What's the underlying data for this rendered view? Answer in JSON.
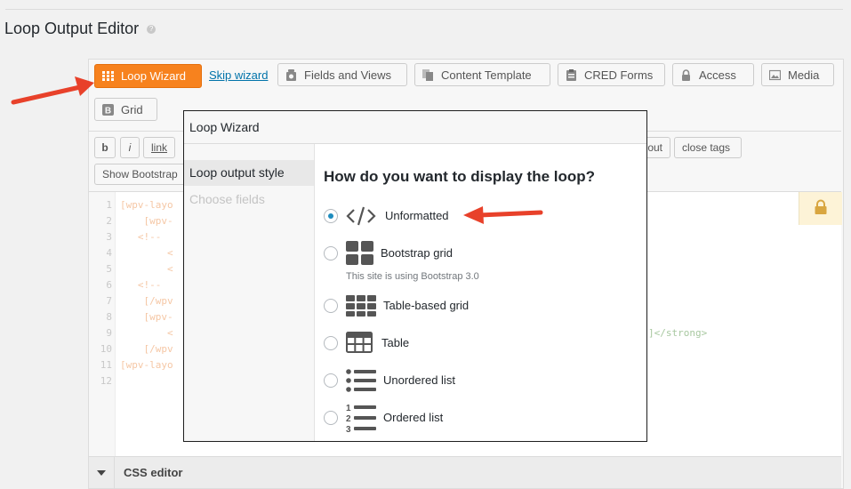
{
  "page": {
    "title": "Loop Output Editor",
    "help": "?"
  },
  "toolbar": {
    "loop_wizard": "Loop Wizard",
    "skip_wizard": "Skip wizard",
    "fields_and_views": "Fields and Views",
    "content_template": "Content Template",
    "cred_forms": "CRED Forms",
    "access": "Access",
    "media": "Media",
    "grid": "Grid"
  },
  "format_buttons": {
    "bold": "b",
    "italic": "i",
    "link": "link",
    "out": "out",
    "close_tags": "close tags",
    "show_bootstrap": "Show Bootstrap"
  },
  "code": {
    "line_numbers": [
      "1",
      "2",
      "3",
      "4",
      "5",
      "6",
      "7",
      "8",
      "9",
      "10",
      "11",
      "12"
    ],
    "lines": [
      "[wpv-layo",
      "    [wpv-",
      "   <!-- ",
      "        <",
      "        <",
      "   <!-- ",
      "    [/wpv",
      "    [wpv-",
      "        <",
      "    [/wpv",
      "[wpv-layo",
      ""
    ],
    "line9_tail": "]</strong>"
  },
  "wizard": {
    "title": "Loop Wizard",
    "steps": [
      "Loop output style",
      "Choose fields"
    ],
    "question": "How do you want to display the loop?",
    "options": [
      {
        "label": "Unformatted",
        "icon": "code-icon",
        "selected": true
      },
      {
        "label": "Bootstrap grid",
        "icon": "bootstrap-grid-icon",
        "selected": false,
        "note": "This site is using Bootstrap 3.0"
      },
      {
        "label": "Table-based grid",
        "icon": "table-grid-icon",
        "selected": false
      },
      {
        "label": "Table",
        "icon": "table-icon",
        "selected": false
      },
      {
        "label": "Unordered list",
        "icon": "unordered-list-icon",
        "selected": false
      },
      {
        "label": "Ordered list",
        "icon": "ordered-list-icon",
        "selected": false
      }
    ],
    "ordered_list_numbers": [
      "1",
      "2",
      "3"
    ]
  },
  "css_editor": {
    "label": "CSS editor"
  },
  "colors": {
    "accent": "#f7821e",
    "link": "#0073aa",
    "annotation_arrow": "#e8412a"
  }
}
